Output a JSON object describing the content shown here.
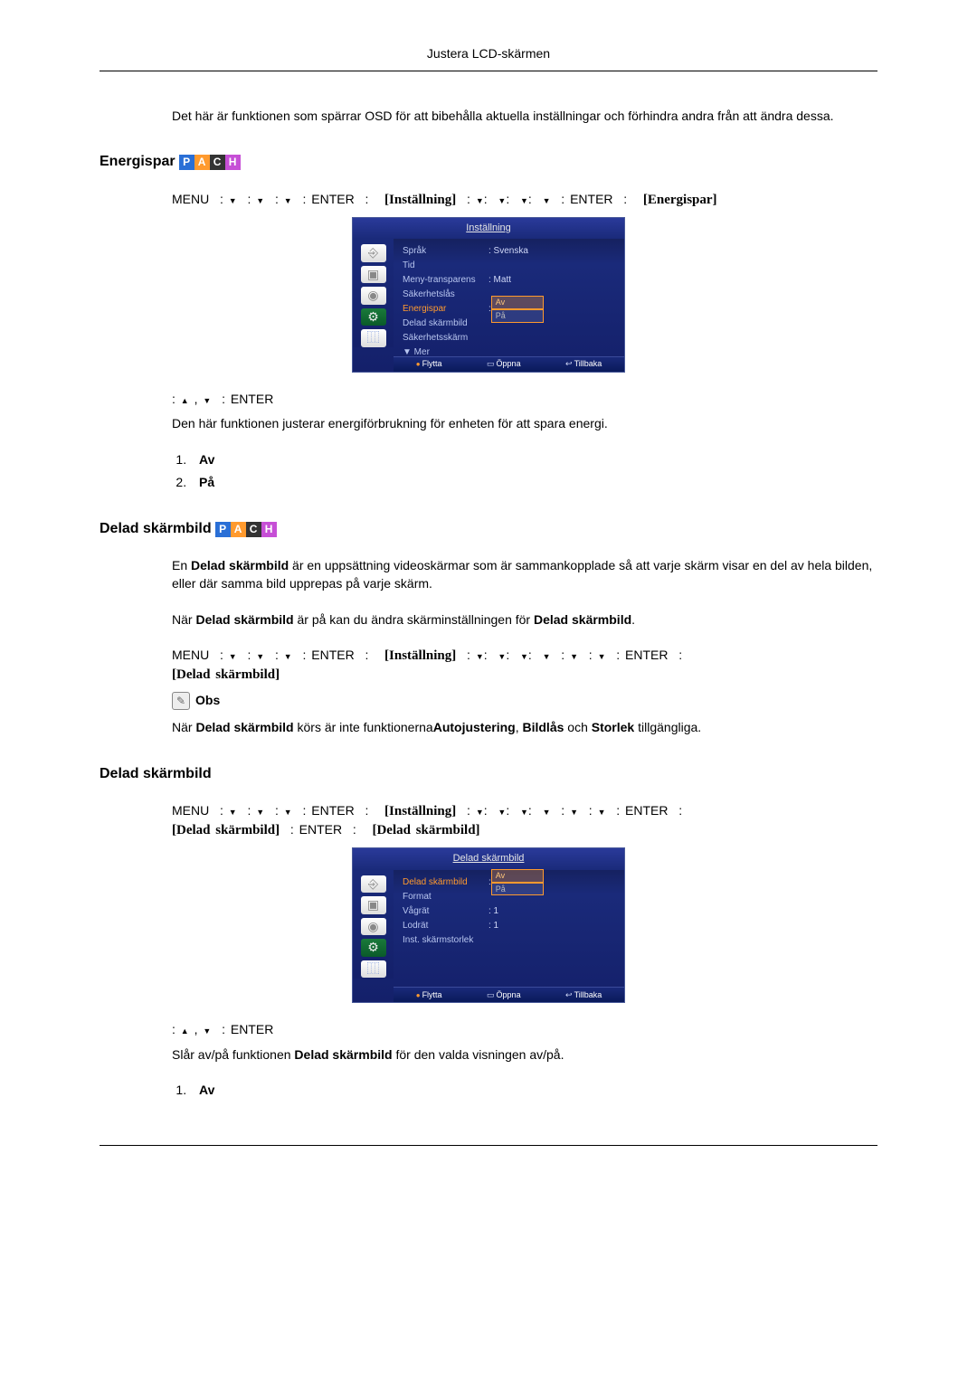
{
  "page_header": "Justera LCD-skärmen",
  "intro_para": "Det här är funktionen som spärrar OSD för att bibehålla aktuella inställningar och förhindra andra från att ändra dessa.",
  "section1": {
    "heading": "Energispar",
    "menu_line_1": {
      "menu": "MENU",
      "enter1": "ENTER",
      "bracket1": "[Inställning]",
      "enter2": "ENTER",
      "bracket2": "[Energispar]"
    },
    "osd1": {
      "title": "Inställning",
      "rows": [
        {
          "label": "Språk",
          "value": ": Svenska"
        },
        {
          "label": "Tid",
          "value": ""
        },
        {
          "label": "Meny-transparens",
          "value": ": Matt"
        },
        {
          "label": "Säkerhetslås",
          "value": ""
        },
        {
          "label_sel": "Energispar",
          "options": [
            "Av",
            "På"
          ]
        },
        {
          "label": "Delad skärmbild",
          "value": ""
        },
        {
          "label": "Säkerhetsskärm",
          "value": ""
        }
      ],
      "more": "▼ Mer",
      "footer": {
        "move": "Flytta",
        "open": "Öppna",
        "back": "Tillbaka"
      }
    },
    "post_line": "ENTER",
    "para": "Den här funktionen justerar energiförbrukning för enheten för att spara energi.",
    "list": [
      "Av",
      "På"
    ]
  },
  "section2": {
    "heading": "Delad skärmbild",
    "para1_a": "En ",
    "para1_b": "Delad skärmbild",
    "para1_c": " är en uppsättning videoskärmar som är sammankopplade så att varje skärm visar en del av hela bilden, eller där samma bild upprepas på varje skärm.",
    "para2_a": "När ",
    "para2_b": "Delad skärmbild",
    "para2_c": " är på kan du ändra skärminställningen för ",
    "para2_d": "Delad skärmbild",
    "para2_e": ".",
    "menu_line": {
      "menu": "MENU",
      "enter1": "ENTER",
      "bracket1": "[Inställning]",
      "enter2": "ENTER",
      "bracket2": "[Delad skärmbild]"
    },
    "note_label": "Obs",
    "note_a": "När ",
    "note_b": "Delad skärmbild",
    "note_c": " körs är inte funktionerna",
    "note_d": "Autojustering",
    "note_e": ", ",
    "note_f": "Bildlås",
    "note_g": "  och ",
    "note_h": "Storlek",
    "note_i": " tillgängliga."
  },
  "section3": {
    "heading": "Delad skärmbild",
    "menu_line": {
      "menu": "MENU",
      "enter1": "ENTER",
      "bracket1": "[Inställning]",
      "enter2": "ENTER",
      "bracket2": "[Delad skärmbild]",
      "enter3": "ENTER",
      "bracket3": "[Delad skärmbild]"
    },
    "osd2": {
      "title": "Delad skärmbild",
      "rows": [
        {
          "label_sel": "Delad skärmbild",
          "options": [
            "Av",
            "På"
          ]
        },
        {
          "label": "Format",
          "value": ""
        },
        {
          "label": "Vågrät",
          "value": ": 1"
        },
        {
          "label": "Lodrät",
          "value": ": 1"
        },
        {
          "label": "Inst. skärmstorlek",
          "value": ""
        }
      ],
      "footer": {
        "move": "Flytta",
        "open": "Öppna",
        "back": "Tillbaka"
      }
    },
    "post_line": "ENTER",
    "para_a": "Slår av/på funktionen ",
    "para_b": "Delad skärmbild",
    "para_c": " för den valda visningen av/på.",
    "list": [
      "Av"
    ]
  }
}
